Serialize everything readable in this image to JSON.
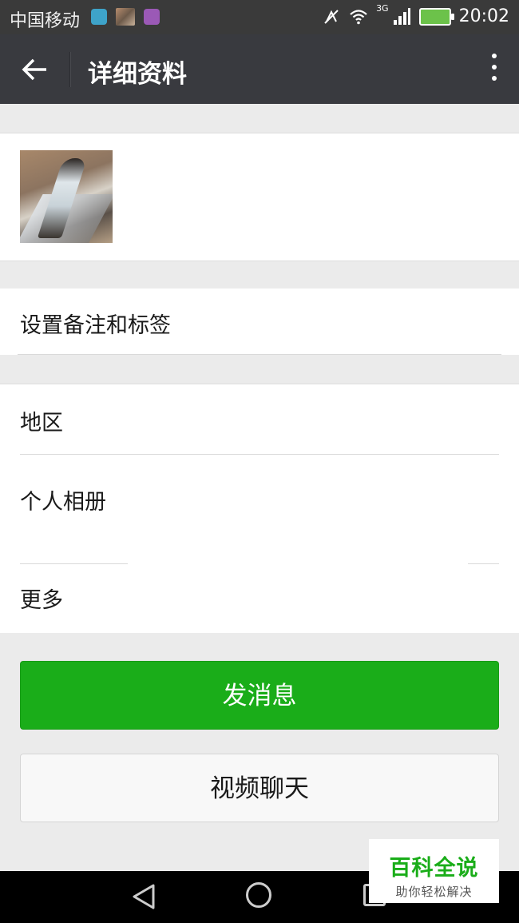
{
  "status_bar": {
    "carrier": "中国移动",
    "network": "3G",
    "time": "20:02",
    "icons": [
      "message-app-icon",
      "photo-thumbnail-icon",
      "gallery-icon",
      "mute-icon",
      "wifi-icon",
      "signal-icon",
      "battery-charging-icon"
    ]
  },
  "header": {
    "title": "详细资料",
    "back_icon": "arrow-left-icon",
    "menu_icon": "more-vertical-icon"
  },
  "profile": {
    "avatar": "avatar-image"
  },
  "remark": {
    "label": "设置备注和标签"
  },
  "info_rows": {
    "region": "地区",
    "album": "个人相册",
    "more": "更多"
  },
  "actions": {
    "send_message": "发消息",
    "video_chat": "视频聊天"
  },
  "watermark": {
    "main": "百科全说",
    "sub": "助你轻松解决"
  },
  "colors": {
    "primary_green": "#1aad19",
    "header_bg": "#393a3f",
    "page_bg": "#ebebeb"
  }
}
